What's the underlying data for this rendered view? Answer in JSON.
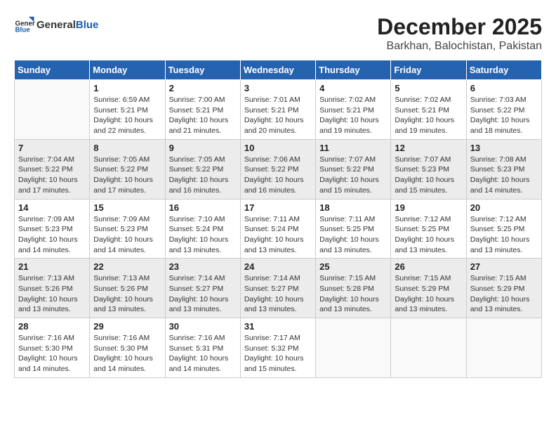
{
  "header": {
    "logo": {
      "general": "General",
      "blue": "Blue"
    },
    "month": "December 2025",
    "location": "Barkhan, Balochistan, Pakistan"
  },
  "weekdays": [
    "Sunday",
    "Monday",
    "Tuesday",
    "Wednesday",
    "Thursday",
    "Friday",
    "Saturday"
  ],
  "weeks": [
    [
      {
        "day": "",
        "info": ""
      },
      {
        "day": "1",
        "info": "Sunrise: 6:59 AM\nSunset: 5:21 PM\nDaylight: 10 hours\nand 22 minutes."
      },
      {
        "day": "2",
        "info": "Sunrise: 7:00 AM\nSunset: 5:21 PM\nDaylight: 10 hours\nand 21 minutes."
      },
      {
        "day": "3",
        "info": "Sunrise: 7:01 AM\nSunset: 5:21 PM\nDaylight: 10 hours\nand 20 minutes."
      },
      {
        "day": "4",
        "info": "Sunrise: 7:02 AM\nSunset: 5:21 PM\nDaylight: 10 hours\nand 19 minutes."
      },
      {
        "day": "5",
        "info": "Sunrise: 7:02 AM\nSunset: 5:21 PM\nDaylight: 10 hours\nand 19 minutes."
      },
      {
        "day": "6",
        "info": "Sunrise: 7:03 AM\nSunset: 5:22 PM\nDaylight: 10 hours\nand 18 minutes."
      }
    ],
    [
      {
        "day": "7",
        "info": "Sunrise: 7:04 AM\nSunset: 5:22 PM\nDaylight: 10 hours\nand 17 minutes."
      },
      {
        "day": "8",
        "info": "Sunrise: 7:05 AM\nSunset: 5:22 PM\nDaylight: 10 hours\nand 17 minutes."
      },
      {
        "day": "9",
        "info": "Sunrise: 7:05 AM\nSunset: 5:22 PM\nDaylight: 10 hours\nand 16 minutes."
      },
      {
        "day": "10",
        "info": "Sunrise: 7:06 AM\nSunset: 5:22 PM\nDaylight: 10 hours\nand 16 minutes."
      },
      {
        "day": "11",
        "info": "Sunrise: 7:07 AM\nSunset: 5:22 PM\nDaylight: 10 hours\nand 15 minutes."
      },
      {
        "day": "12",
        "info": "Sunrise: 7:07 AM\nSunset: 5:23 PM\nDaylight: 10 hours\nand 15 minutes."
      },
      {
        "day": "13",
        "info": "Sunrise: 7:08 AM\nSunset: 5:23 PM\nDaylight: 10 hours\nand 14 minutes."
      }
    ],
    [
      {
        "day": "14",
        "info": "Sunrise: 7:09 AM\nSunset: 5:23 PM\nDaylight: 10 hours\nand 14 minutes."
      },
      {
        "day": "15",
        "info": "Sunrise: 7:09 AM\nSunset: 5:23 PM\nDaylight: 10 hours\nand 14 minutes."
      },
      {
        "day": "16",
        "info": "Sunrise: 7:10 AM\nSunset: 5:24 PM\nDaylight: 10 hours\nand 13 minutes."
      },
      {
        "day": "17",
        "info": "Sunrise: 7:11 AM\nSunset: 5:24 PM\nDaylight: 10 hours\nand 13 minutes."
      },
      {
        "day": "18",
        "info": "Sunrise: 7:11 AM\nSunset: 5:25 PM\nDaylight: 10 hours\nand 13 minutes."
      },
      {
        "day": "19",
        "info": "Sunrise: 7:12 AM\nSunset: 5:25 PM\nDaylight: 10 hours\nand 13 minutes."
      },
      {
        "day": "20",
        "info": "Sunrise: 7:12 AM\nSunset: 5:25 PM\nDaylight: 10 hours\nand 13 minutes."
      }
    ],
    [
      {
        "day": "21",
        "info": "Sunrise: 7:13 AM\nSunset: 5:26 PM\nDaylight: 10 hours\nand 13 minutes."
      },
      {
        "day": "22",
        "info": "Sunrise: 7:13 AM\nSunset: 5:26 PM\nDaylight: 10 hours\nand 13 minutes."
      },
      {
        "day": "23",
        "info": "Sunrise: 7:14 AM\nSunset: 5:27 PM\nDaylight: 10 hours\nand 13 minutes."
      },
      {
        "day": "24",
        "info": "Sunrise: 7:14 AM\nSunset: 5:27 PM\nDaylight: 10 hours\nand 13 minutes."
      },
      {
        "day": "25",
        "info": "Sunrise: 7:15 AM\nSunset: 5:28 PM\nDaylight: 10 hours\nand 13 minutes."
      },
      {
        "day": "26",
        "info": "Sunrise: 7:15 AM\nSunset: 5:29 PM\nDaylight: 10 hours\nand 13 minutes."
      },
      {
        "day": "27",
        "info": "Sunrise: 7:15 AM\nSunset: 5:29 PM\nDaylight: 10 hours\nand 13 minutes."
      }
    ],
    [
      {
        "day": "28",
        "info": "Sunrise: 7:16 AM\nSunset: 5:30 PM\nDaylight: 10 hours\nand 14 minutes."
      },
      {
        "day": "29",
        "info": "Sunrise: 7:16 AM\nSunset: 5:30 PM\nDaylight: 10 hours\nand 14 minutes."
      },
      {
        "day": "30",
        "info": "Sunrise: 7:16 AM\nSunset: 5:31 PM\nDaylight: 10 hours\nand 14 minutes."
      },
      {
        "day": "31",
        "info": "Sunrise: 7:17 AM\nSunset: 5:32 PM\nDaylight: 10 hours\nand 15 minutes."
      },
      {
        "day": "",
        "info": ""
      },
      {
        "day": "",
        "info": ""
      },
      {
        "day": "",
        "info": ""
      }
    ]
  ]
}
